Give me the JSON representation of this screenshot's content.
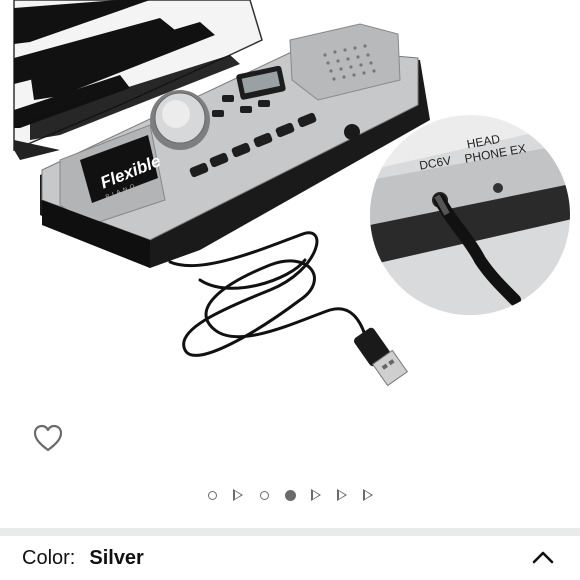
{
  "product_image": {
    "alt": "Flexible roll-up piano with USB cable",
    "brand_text": "Flexible",
    "brand_subtext": "PIANO",
    "port_labels": [
      "HEAD",
      "PHONE EX",
      "DC6V"
    ]
  },
  "carousel": {
    "indicators": [
      {
        "type": "dot",
        "active": false
      },
      {
        "type": "video",
        "active": false
      },
      {
        "type": "dot",
        "active": false
      },
      {
        "type": "dot",
        "active": true
      },
      {
        "type": "video",
        "active": false
      },
      {
        "type": "video",
        "active": false
      },
      {
        "type": "video",
        "active": false
      }
    ]
  },
  "wishlist": {
    "icon": "heart-outline-icon"
  },
  "variant": {
    "label": "Color:",
    "value": "Silver",
    "icon": "chevron-up-icon"
  },
  "colors": {
    "divider": "#e9ebeb",
    "indicator": "#6b6b6b",
    "device_silver": "#c8c9cb",
    "device_black": "#1b1b1b"
  }
}
